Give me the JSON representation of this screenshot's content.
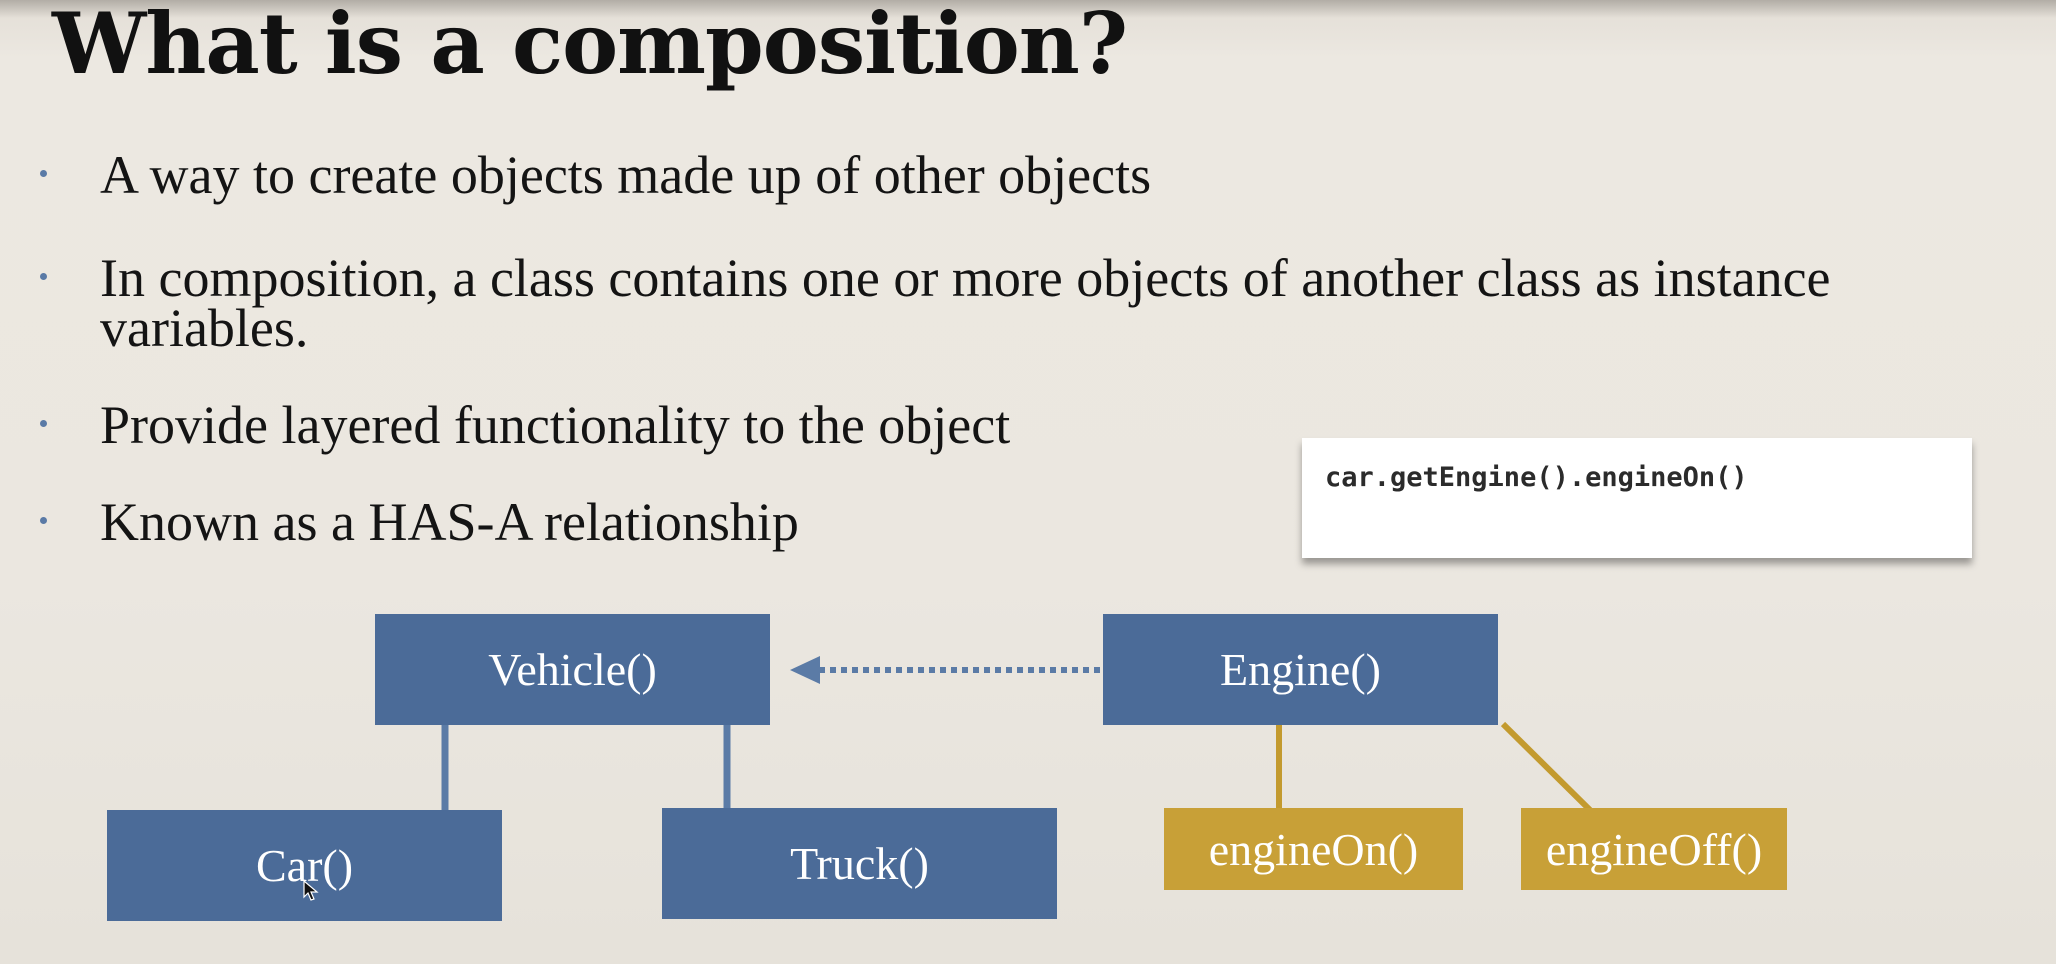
{
  "slide": {
    "title": "What is a composition?",
    "bullets": [
      "A way to create objects made up of other objects",
      "In composition, a class contains one or more objects of another class as instance variables.",
      "Provide layered functionality to the object",
      "Known as a HAS-A relationship"
    ],
    "code": "car.getEngine().engineOn()"
  },
  "diagram": {
    "nodes": {
      "vehicle": "Vehicle()",
      "engine": "Engine()",
      "car": "Car()",
      "truck": "Truck()",
      "engine_on": "engineOn()",
      "engine_off": "engineOff()"
    },
    "colors": {
      "class_box": "#4b6b98",
      "method_box": "#c8a037",
      "connector_blue": "#5b7ba6",
      "connector_gold": "#c39a2e"
    }
  }
}
